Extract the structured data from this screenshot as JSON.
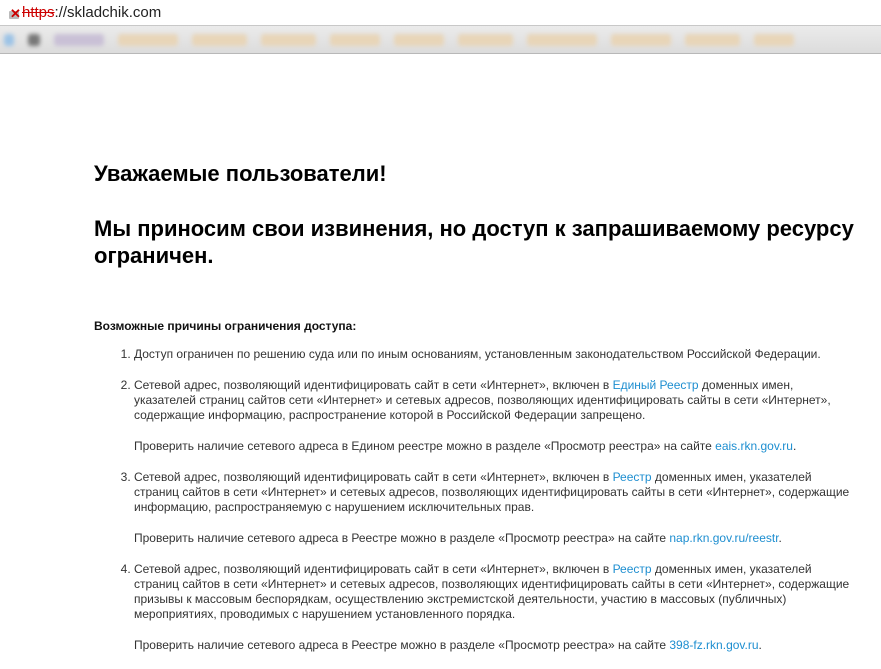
{
  "browser": {
    "url_scheme": "https",
    "url_rest": "://skladchik.com"
  },
  "page": {
    "greeting": "Уважаемые пользователи!",
    "apology": "Мы приносим свои извинения, но доступ к запрашиваемому ресурсу ограничен.",
    "reasons_title": "Возможные причины ограничения доступа:",
    "items": [
      {
        "before": "Доступ ограничен  по решению суда или по иным основаниям, установленным законодательством Российской Федерации.",
        "link": "",
        "after": ""
      },
      {
        "before": "Сетевой адрес, позволяющий идентифицировать сайт в сети «Интернет», включен в ",
        "link": "Единый Реестр",
        "after": " доменных имен, указателей страниц сайтов сети «Интернет» и сетевых адресов, позволяющих идентифицировать сайты в сети «Интернет», содержащие информацию, распространение которой в Российской Федерации запрещено.",
        "check_before": "Проверить наличие сетевого адреса в Едином реестре можно в разделе «Просмотр реестра» на сайте ",
        "check_link": "eais.rkn.gov.ru",
        "check_after": "."
      },
      {
        "before": "Сетевой адрес, позволяющий идентифицировать сайт в сети «Интернет», включен в ",
        "link": "Реестр",
        "after": " доменных имен, указателей страниц сайтов в сети «Интернет» и сетевых адресов, позволяющих идентифицировать сайты в сети «Интернет», содержащие информацию, распространяемую с нарушением исключительных прав.",
        "check_before": "Проверить наличие сетевого адреса в Реестре можно в разделе «Просмотр реестра» на сайте ",
        "check_link": "nap.rkn.gov.ru/reestr",
        "check_after": "."
      },
      {
        "before": "Сетевой адрес, позволяющий идентифицировать сайт в сети «Интернет», включен в ",
        "link": "Реестр",
        "after": " доменных имен, указателей страниц сайтов в сети «Интернет» и сетевых адресов, позволяющих идентифицировать сайты в сети «Интернет», содержащие призывы к массовым беспорядкам, осуществлению экстремистской деятельности, участию в массовых (публичных) мероприятиях, проводимых с нарушением установленного порядка.",
        "check_before": "Проверить наличие сетевого адреса в Реестре можно в разделе «Просмотр реестра» на сайте ",
        "check_link": "398-fz.rkn.gov.ru",
        "check_after": "."
      }
    ]
  }
}
